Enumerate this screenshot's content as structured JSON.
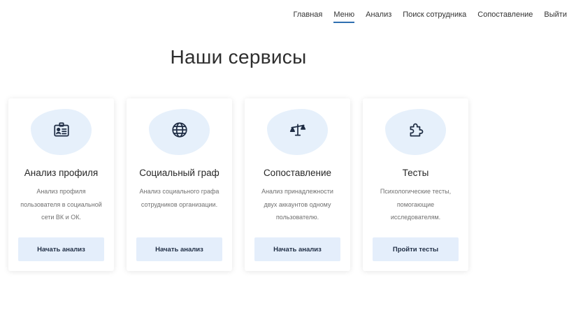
{
  "nav": {
    "items": [
      {
        "label": "Главная"
      },
      {
        "label": "Меню"
      },
      {
        "label": "Анализ"
      },
      {
        "label": "Поиск сотрудника"
      },
      {
        "label": "Сопоставление"
      },
      {
        "label": "Выйти"
      }
    ],
    "active": "Меню"
  },
  "page": {
    "title": "Наши сервисы"
  },
  "services": [
    {
      "icon": "id-card-icon",
      "title": "Анализ профиля",
      "description": "Анализ профиля пользователя в социальной сети ВК и ОК.",
      "button": "Начать анализ"
    },
    {
      "icon": "globe-icon",
      "title": "Социальный граф",
      "description": "Анализ социального графа сотрудников организации.",
      "button": "Начать анализ"
    },
    {
      "icon": "scales-icon",
      "title": "Сопоставление",
      "description": "Анализ принадлежности двух аккаунтов одному пользователю.",
      "button": "Начать анализ"
    },
    {
      "icon": "puzzle-icon",
      "title": "Тесты",
      "description": "Психологические тесты, помогающие исследователям.",
      "button": "Пройти тесты"
    }
  ],
  "colors": {
    "accent": "#2f6fb0",
    "blob": "#e6f0fb",
    "button_bg": "#e4eefb",
    "icon": "#1f2d44"
  }
}
